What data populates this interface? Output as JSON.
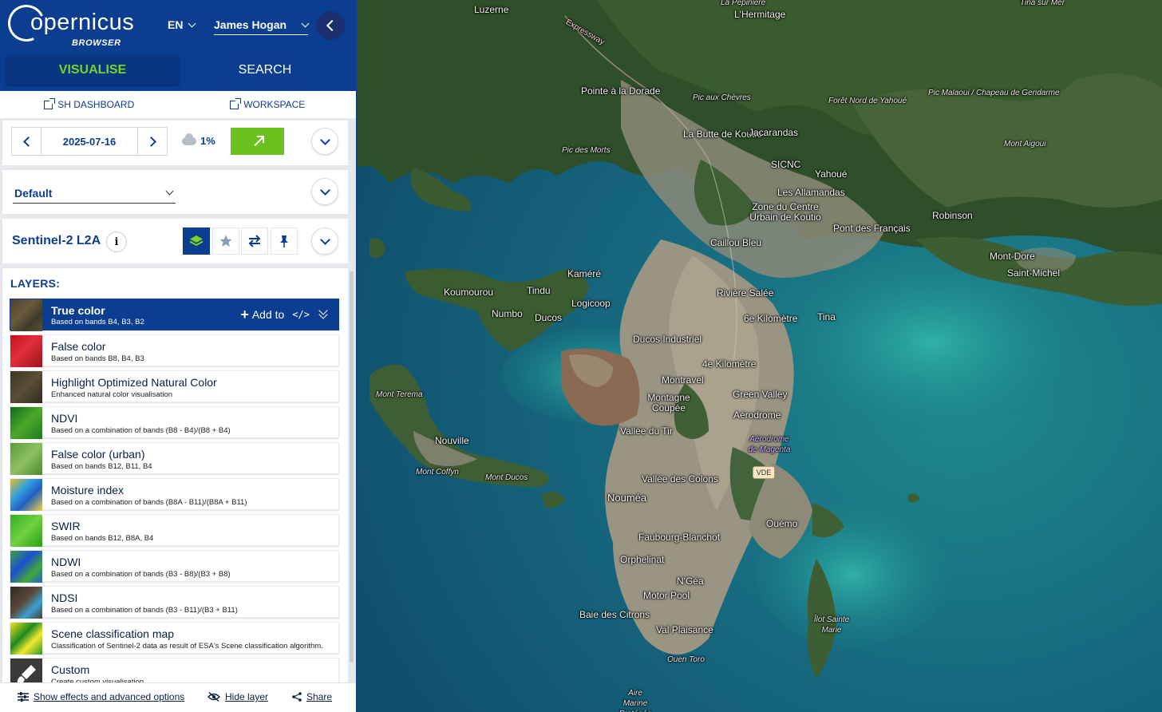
{
  "header": {
    "logo_main": "opernicus",
    "logo_sub": "BROWSER",
    "language": "EN",
    "user_name": "James Hogan",
    "tabs": [
      {
        "label": "VISUALISE",
        "active": true
      },
      {
        "label": "SEARCH",
        "active": false
      }
    ]
  },
  "links": {
    "dashboard": "SH DASHBOARD",
    "workspace": "WORKSPACE"
  },
  "date_panel": {
    "date": "2025-07-16",
    "cloud_coverage": "1%"
  },
  "theme": {
    "selected": "Default"
  },
  "collection": {
    "title": "Sentinel-2 L2A",
    "info": "i",
    "tools": [
      "layers-icon",
      "star-icon",
      "compare-icon",
      "pin-icon"
    ]
  },
  "layers": {
    "title": "LAYERS:",
    "add_to_label": "Add to",
    "code_label": "</>",
    "items": [
      {
        "name": "True color",
        "desc": "Based on bands B4, B3, B2",
        "active": true,
        "thumb": "true-color"
      },
      {
        "name": "False color",
        "desc": "Based on bands B8, B4, B3",
        "active": false,
        "thumb": "false-color"
      },
      {
        "name": "Highlight Optimized Natural Color",
        "desc": "Enhanced natural color visualisation",
        "active": false,
        "thumb": "highlight"
      },
      {
        "name": "NDVI",
        "desc": "Based on a combination of bands (B8 - B4)/(B8 + B4)",
        "active": false,
        "thumb": "ndvi"
      },
      {
        "name": "False color (urban)",
        "desc": "Based on bands B12, B11, B4",
        "active": false,
        "thumb": "urban"
      },
      {
        "name": "Moisture index",
        "desc": "Based on a combination of bands (B8A - B11)/(B8A + B11)",
        "active": false,
        "thumb": "moisture"
      },
      {
        "name": "SWIR",
        "desc": "Based on bands B12, B8A, B4",
        "active": false,
        "thumb": "swir"
      },
      {
        "name": "NDWI",
        "desc": "Based on a combination of bands (B3 - B8)/(B3 + B8)",
        "active": false,
        "thumb": "ndwi"
      },
      {
        "name": "NDSI",
        "desc": "Based on a combination of bands (B3 - B11)/(B3 + B11)",
        "active": false,
        "thumb": "ndsi"
      },
      {
        "name": "Scene classification map",
        "desc": "Classification of Sentinel-2 data as result of ESA's Scene classification algorithm.",
        "active": false,
        "thumb": "scl"
      },
      {
        "name": "Custom",
        "desc": "Create custom visualisation",
        "active": false,
        "thumb": "custom"
      }
    ]
  },
  "bottom_bar": {
    "effects": "Show effects and advanced options",
    "hide": "Hide layer",
    "share": "Share"
  },
  "map": {
    "labels": [
      "Luzerne",
      "L'Hermitage",
      "La Pépinière",
      "Tina sur Mer",
      "Expressway",
      "Pointe à la Dorade",
      "Pic aux Chèvres",
      "Pic Malaoui / Chapeau de Gendarme",
      "Forêt Nord de Yahoué",
      "La Butte de Koutio",
      "Jacarandas",
      "SICNC",
      "Yahoué",
      "Les Allamandas",
      "Zone du Centre Urbain de Koutio",
      "Robinson",
      "Pont des Français",
      "Mont Aigoui",
      "Pic des Morts",
      "Caillou Bleu",
      "Mont-Dore",
      "Saint-Michel",
      "Kaméré",
      "Koumourou",
      "Tindu",
      "Logicoop",
      "Rivière Salée",
      "Numbo",
      "Ducos",
      "6e Kilomètre",
      "Tina",
      "Ducos Industriel",
      "4e Kilomètre",
      "Montravel",
      "Green Valley",
      "Montagne Coupée",
      "Aérodrome",
      "Vallée du Tir",
      "Aérodrome de Magenta",
      "Nouville",
      "Mont Terema",
      "Mont Coffyn",
      "Mont Ducos",
      "VDE",
      "Vallée des Colons",
      "Nouméa",
      "Ouémo",
      "Faubourg-Blanchot",
      "Orphelinat",
      "N'Géa",
      "Motor Pool",
      "Baie des Citrons",
      "Val Plaisance",
      "Ouen Toro",
      "Îlot Sainte Marie",
      "Aire Marine Protégée"
    ]
  }
}
